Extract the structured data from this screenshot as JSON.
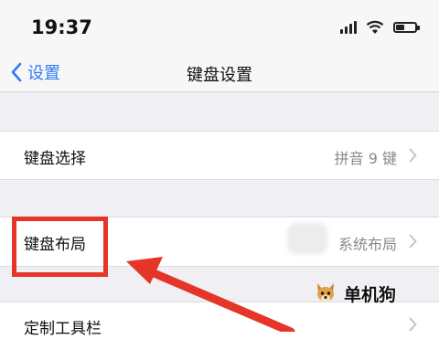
{
  "status_bar": {
    "time": "19:37",
    "icons": [
      "signal-icon",
      "wifi-icon",
      "battery-icon"
    ]
  },
  "nav": {
    "back_label": "设置",
    "title": "键盘设置"
  },
  "rows": [
    {
      "label": "键盘选择",
      "value": "拼音 9 键"
    },
    {
      "label": "键盘布局",
      "value": "系统布局"
    },
    {
      "label": "定制工具栏",
      "value": ""
    }
  ],
  "watermark": {
    "text": "单机狗"
  },
  "colors": {
    "accent": "#2e7cf6",
    "annotation_red": "#e53529",
    "background": "#efeff4",
    "value_gray": "#8a8a8e"
  }
}
